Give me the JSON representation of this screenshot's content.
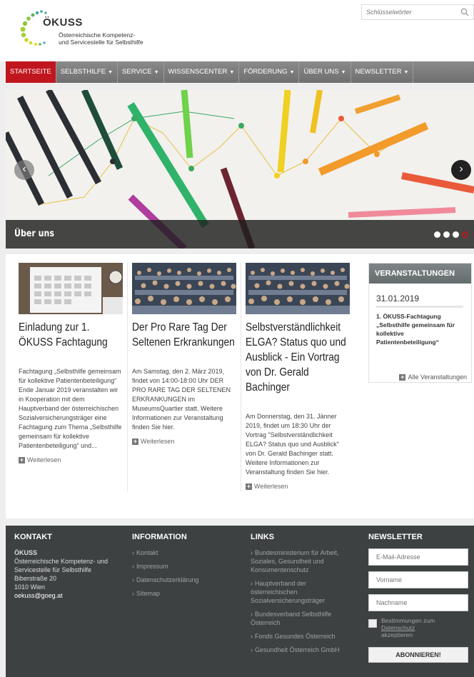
{
  "header": {
    "logo_title": "ÖKUSS",
    "logo_sub1": "Österreichische Kompetenz-",
    "logo_sub2": "und Servicestelle für Selbsthilfe",
    "search_placeholder": "Schlüsselwörter"
  },
  "nav": {
    "items": [
      {
        "label": "STARTSEITE",
        "caret": ""
      },
      {
        "label": "SELBSTHILFE",
        "caret": "▼"
      },
      {
        "label": "SERVICE",
        "caret": "▼"
      },
      {
        "label": "WISSENSCENTER",
        "caret": "▼"
      },
      {
        "label": "FÖRDERUNG",
        "caret": "▼"
      },
      {
        "label": "ÜBER UNS",
        "caret": "▼"
      },
      {
        "label": "NEWSLETTER",
        "caret": "▼"
      }
    ]
  },
  "slider": {
    "caption": "Über uns",
    "prev": "‹",
    "next": "›"
  },
  "articles": [
    {
      "title": "Einladung zur 1. ÖKUSS Fachtagung",
      "text": "Fachtagung „Selbsthilfe gemeinsam für kollektive Patientenbeteiligung“ Ende Januar 2019 veranstalten wir in Kooperation mit dem Hauptverband der österreichischen Sozialversicherungsträger eine Fachtagung zum Thema „Selbsthilfe gemeinsam für kollektive Patientenbeteiligung“ und...",
      "more": "Weiterlesen"
    },
    {
      "title": "Der Pro Rare Tag Der Seltenen Erkrankungen",
      "text": "Am Samstag, den 2. März 2019, findet von 14:00-18:00 Uhr DER PRO RARE TAG DER SELTENEN ERKRANKUNGEN im MuseumsQuartier statt. Weitere Informationen zur Veranstaltung finden Sie hier.",
      "more": "Weiterlesen"
    },
    {
      "title": "Selbstverständlichkeit ELGA? Status quo und Ausblick - Ein Vortrag von Dr. Gerald Bachinger",
      "text": "Am Donnerstag, den 31. Jänner 2019, findet um 18:30 Uhr der Vortrag \"Selbstverständlichkeit ELGA? Status quo und Ausblick\" von Dr. Gerald Bachinger statt. Weitere Informationen zur Veranstaltung finden Sie hier.",
      "more": "Weiterlesen"
    }
  ],
  "events": {
    "heading": "VERANSTALTUNGEN",
    "date": "31.01.2019",
    "text": "1. ÖKUSS-Fachtagung „Selbsthilfe gemeinsam für kollektive Patientenbeteiligung“",
    "all": "Alle Veranstaltungen"
  },
  "footer": {
    "kontakt": {
      "heading": "KONTAKT",
      "name": "ÖKUSS",
      "line1": "Österreichische Kompetenz- und Servicestelle für Selbsthilfe",
      "street": "Biberstraße 20",
      "city": "1010 Wien",
      "email": "oekuss@goeg.at"
    },
    "information": {
      "heading": "INFORMATION",
      "links": [
        "Kontakt",
        "Impressum",
        "Datenschutzerklärung",
        "Sitemap"
      ]
    },
    "links": {
      "heading": "LINKS",
      "links": [
        "Bundesministerium für Arbeit, Soziales, Gesundheit und Konsumentenschutz",
        "Hauptverband der österreichischen Sozialversicherungsträger",
        "Bundesverband Selbsthilfe Österreich",
        "Fonds Gesundes Österreich",
        "Gesundheit Österreich GmbH"
      ]
    },
    "newsletter": {
      "heading": "NEWSLETTER",
      "email_placeholder": "E-Mail-Adresse",
      "first_placeholder": "Vorname",
      "last_placeholder": "Nachname",
      "consent_pre": "Bestimmungen zum",
      "consent_link": "Datenschutz",
      "consent_post": "akzeptieren",
      "button": "ABONNIEREN!"
    }
  },
  "colors": {
    "accent_red": "#c0161d",
    "nav_gray": "#7a7a7a",
    "footer_bg": "#3d4142"
  }
}
